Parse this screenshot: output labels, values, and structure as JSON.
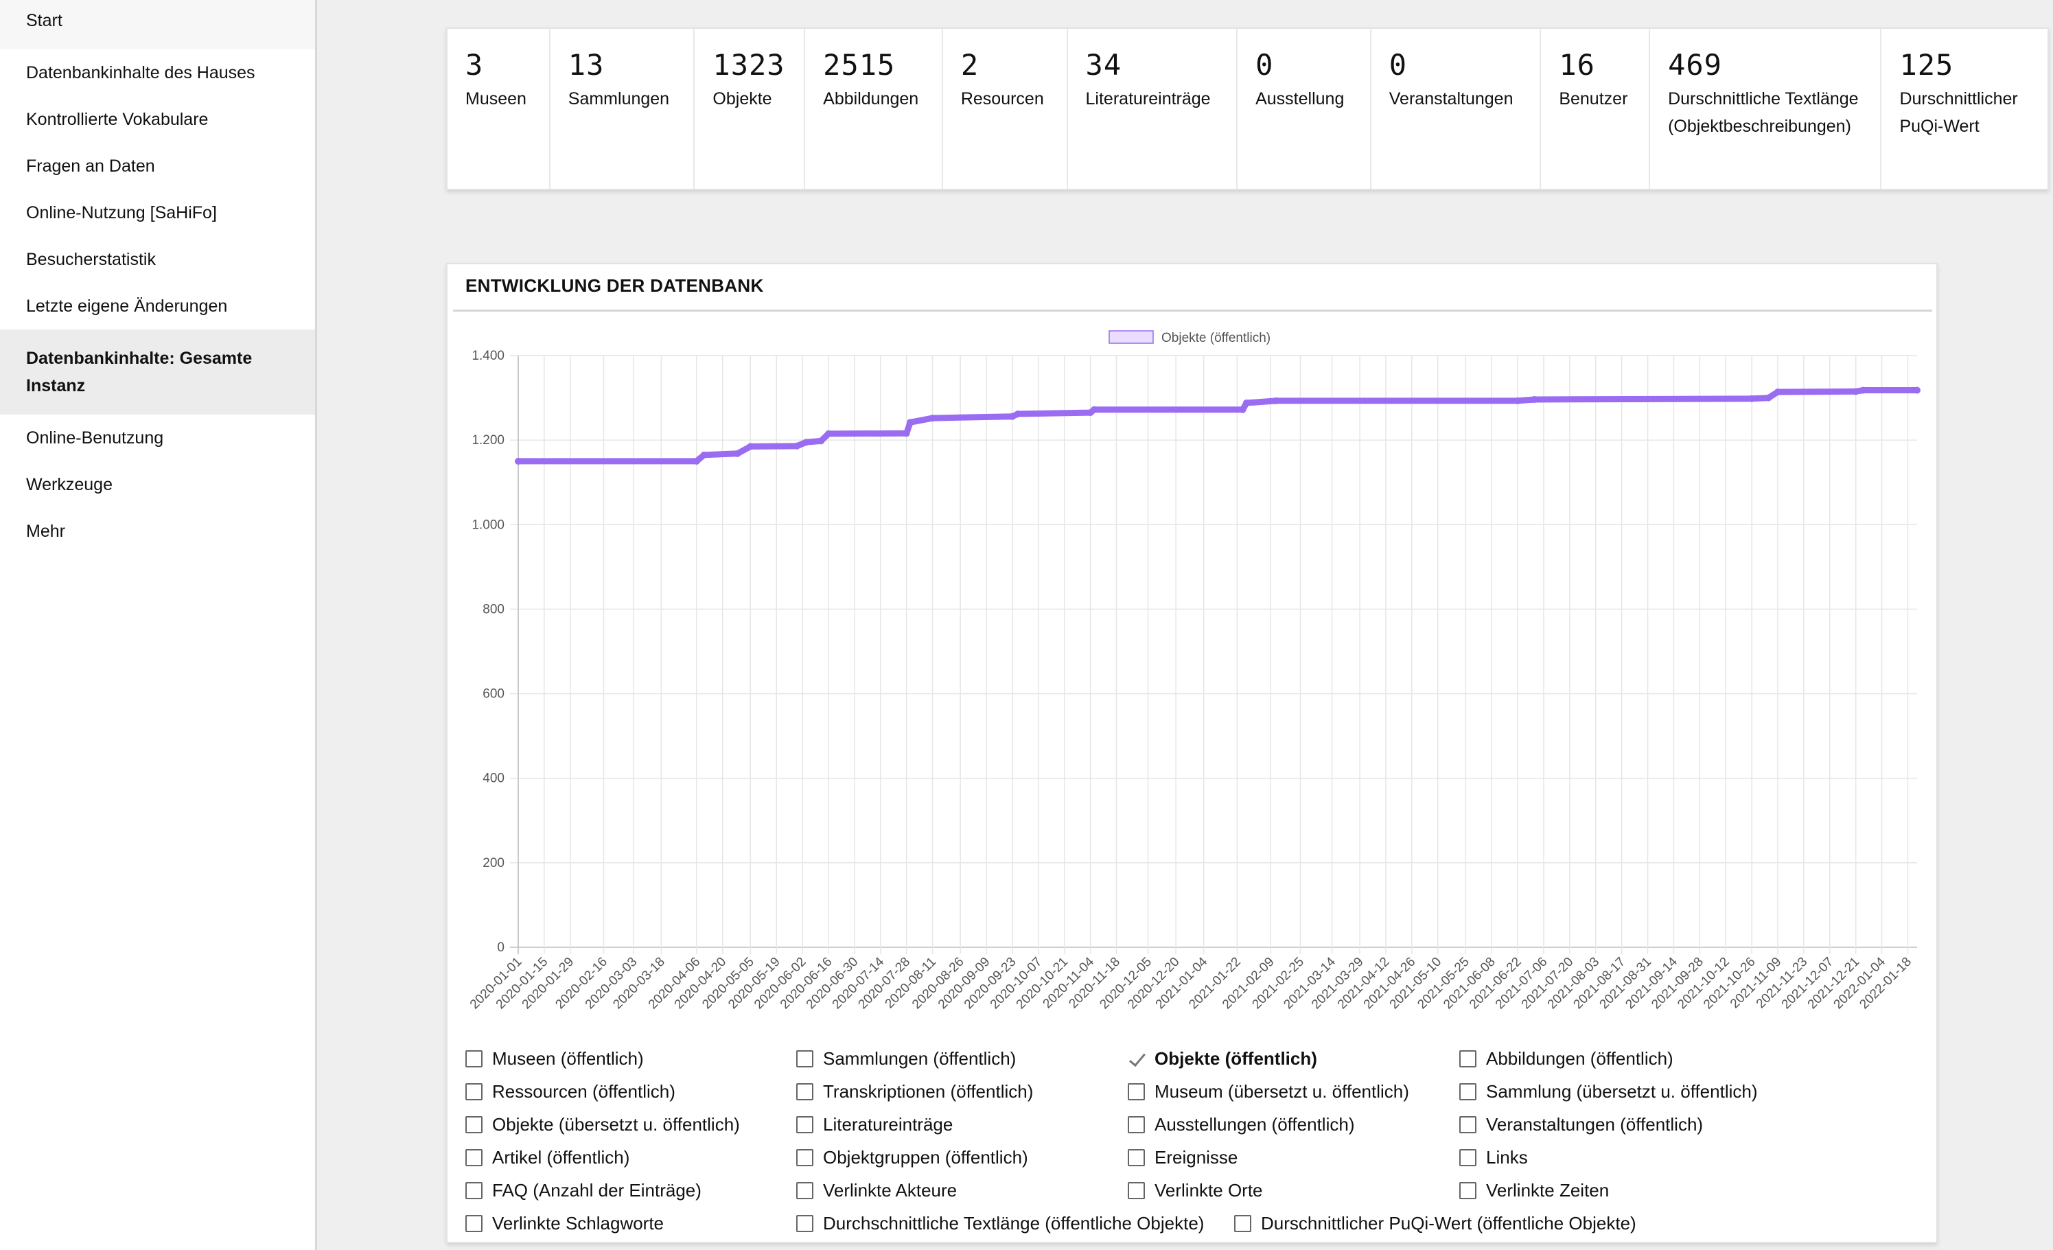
{
  "sidebar": {
    "items": [
      {
        "label": "Start"
      },
      {
        "label": "Datenbankinhalte des Hauses"
      },
      {
        "label": "Kontrollierte Vokabulare"
      },
      {
        "label": "Fragen an Daten"
      },
      {
        "label": "Online-Nutzung [SaHiFo]"
      },
      {
        "label": "Besucherstatistik"
      },
      {
        "label": "Letzte eigene Änderungen"
      },
      {
        "label": "Datenbankinhalte: Gesamte Instanz",
        "active": true
      },
      {
        "label": "Online-Benutzung"
      },
      {
        "label": "Werkzeuge"
      },
      {
        "label": "Mehr"
      }
    ]
  },
  "stats": [
    {
      "value": "3",
      "label": "Museen"
    },
    {
      "value": "13",
      "label": "Sammlungen"
    },
    {
      "value": "1323",
      "label": "Objekte"
    },
    {
      "value": "2515",
      "label": "Abbildungen"
    },
    {
      "value": "2",
      "label": "Resourcen"
    },
    {
      "value": "34",
      "label": "Literatureinträge"
    },
    {
      "value": "0",
      "label": "Ausstellung"
    },
    {
      "value": "0",
      "label": "Veranstaltungen"
    },
    {
      "value": "16",
      "label": "Benutzer"
    },
    {
      "value": "469",
      "label": "Durschnittliche Textlänge (Objektbeschreibungen)"
    },
    {
      "value": "125",
      "label": "Durschnittlicher PuQi-Wert"
    }
  ],
  "card": {
    "title": "ENTWICKLUNG DER DATENBANK"
  },
  "chart_data": {
    "type": "line",
    "title": "",
    "xlabel": "",
    "ylabel": "",
    "ylim": [
      0,
      1400
    ],
    "yticks": [
      0,
      200,
      400,
      600,
      800,
      1000,
      1200,
      1400
    ],
    "ytick_labels": [
      "0",
      "200",
      "400",
      "600",
      "800",
      "1.000",
      "1.200",
      "1.400"
    ],
    "xtick_labels": [
      "2020-01-01",
      "2020-01-15",
      "2020-01-29",
      "2020-02-16",
      "2020-03-03",
      "2020-03-18",
      "2020-04-06",
      "2020-04-20",
      "2020-05-05",
      "2020-05-19",
      "2020-06-02",
      "2020-06-16",
      "2020-06-30",
      "2020-07-14",
      "2020-07-28",
      "2020-08-11",
      "2020-08-26",
      "2020-09-09",
      "2020-09-23",
      "2020-10-07",
      "2020-10-21",
      "2020-11-04",
      "2020-11-18",
      "2020-12-05",
      "2020-12-20",
      "2021-01-04",
      "2021-01-22",
      "2021-02-09",
      "2021-02-25",
      "2021-03-14",
      "2021-03-29",
      "2021-04-12",
      "2021-04-26",
      "2021-05-10",
      "2021-05-25",
      "2021-06-08",
      "2021-06-22",
      "2021-07-06",
      "2021-07-20",
      "2021-08-03",
      "2021-08-17",
      "2021-08-31",
      "2021-09-14",
      "2021-09-28",
      "2021-10-12",
      "2021-10-26",
      "2021-11-09",
      "2021-11-23",
      "2021-12-07",
      "2021-12-21",
      "2022-01-04",
      "2022-01-18"
    ],
    "grid": true,
    "legend_position": "top-center",
    "series": [
      {
        "name": "Objekte (öffentlich)",
        "color": "#9a6cf2",
        "points": [
          {
            "x": "2020-01-01",
            "y": 1150
          },
          {
            "x": "2020-04-06",
            "y": 1150
          },
          {
            "x": "2020-04-10",
            "y": 1165
          },
          {
            "x": "2020-04-28",
            "y": 1168
          },
          {
            "x": "2020-05-05",
            "y": 1185
          },
          {
            "x": "2020-05-30",
            "y": 1186
          },
          {
            "x": "2020-06-04",
            "y": 1195
          },
          {
            "x": "2020-06-12",
            "y": 1198
          },
          {
            "x": "2020-06-16",
            "y": 1215
          },
          {
            "x": "2020-07-28",
            "y": 1216
          },
          {
            "x": "2020-07-30",
            "y": 1242
          },
          {
            "x": "2020-08-11",
            "y": 1252
          },
          {
            "x": "2020-09-23",
            "y": 1256
          },
          {
            "x": "2020-09-26",
            "y": 1262
          },
          {
            "x": "2020-11-04",
            "y": 1265
          },
          {
            "x": "2020-11-06",
            "y": 1272
          },
          {
            "x": "2021-01-25",
            "y": 1272
          },
          {
            "x": "2021-01-27",
            "y": 1288
          },
          {
            "x": "2021-02-12",
            "y": 1293
          },
          {
            "x": "2021-06-22",
            "y": 1293
          },
          {
            "x": "2021-07-01",
            "y": 1296
          },
          {
            "x": "2021-10-26",
            "y": 1298
          },
          {
            "x": "2021-11-04",
            "y": 1300
          },
          {
            "x": "2021-11-09",
            "y": 1314
          },
          {
            "x": "2021-12-21",
            "y": 1315
          },
          {
            "x": "2021-12-25",
            "y": 1318
          },
          {
            "x": "2022-01-23",
            "y": 1318
          }
        ]
      }
    ]
  },
  "checkboxes": [
    {
      "label": "Museen (öffentlich)",
      "checked": false
    },
    {
      "label": "Sammlungen (öffentlich)",
      "checked": false
    },
    {
      "label": "Objekte (öffentlich)",
      "checked": true
    },
    {
      "label": "Abbildungen (öffentlich)",
      "checked": false
    },
    {
      "label": "Ressourcen (öffentlich)",
      "checked": false
    },
    {
      "label": "Transkriptionen (öffentlich)",
      "checked": false
    },
    {
      "label": "Museum (übersetzt u. öffentlich)",
      "checked": false
    },
    {
      "label": "Sammlung (übersetzt u. öffentlich)",
      "checked": false
    },
    {
      "label": "Objekte (übersetzt u. öffentlich)",
      "checked": false
    },
    {
      "label": "Literatureinträge",
      "checked": false
    },
    {
      "label": "Ausstellungen (öffentlich)",
      "checked": false
    },
    {
      "label": "Veranstaltungen (öffentlich)",
      "checked": false
    },
    {
      "label": "Artikel (öffentlich)",
      "checked": false
    },
    {
      "label": "Objektgruppen (öffentlich)",
      "checked": false
    },
    {
      "label": "Ereignisse",
      "checked": false
    },
    {
      "label": "Links",
      "checked": false
    },
    {
      "label": "FAQ (Anzahl der Einträge)",
      "checked": false
    },
    {
      "label": "Verlinkte Akteure",
      "checked": false
    },
    {
      "label": "Verlinkte Orte",
      "checked": false
    },
    {
      "label": "Verlinkte Zeiten",
      "checked": false
    },
    {
      "label": "Verlinkte Schlagworte",
      "checked": false
    },
    {
      "label": "Durchschnittliche Textlänge (öffentliche Objekte)",
      "checked": false
    },
    {
      "label": "Durschnittlicher PuQi-Wert (öffentliche Objekte)",
      "checked": false
    }
  ]
}
